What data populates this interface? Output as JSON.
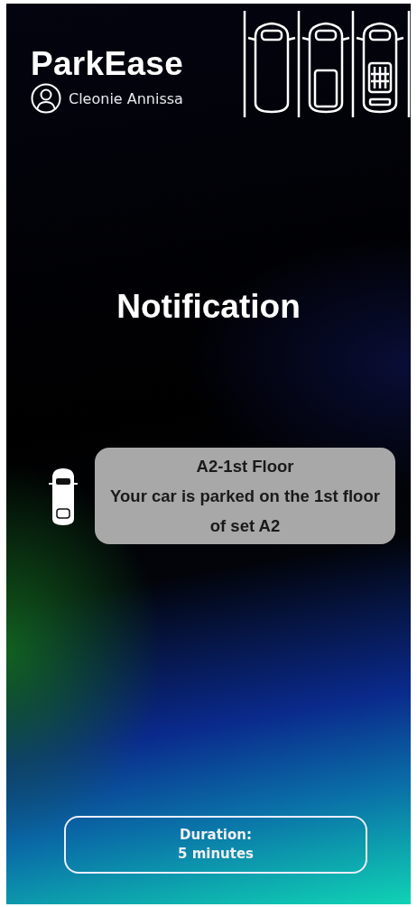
{
  "app": {
    "title": "ParkEase",
    "user": "Cleonie Annissa"
  },
  "heading": "Notification",
  "notification": {
    "title": "A2-1st Floor",
    "message": "Your car is parked on the 1st floor of set A2"
  },
  "duration": {
    "label": "Duration:",
    "value": "5 minutes"
  }
}
